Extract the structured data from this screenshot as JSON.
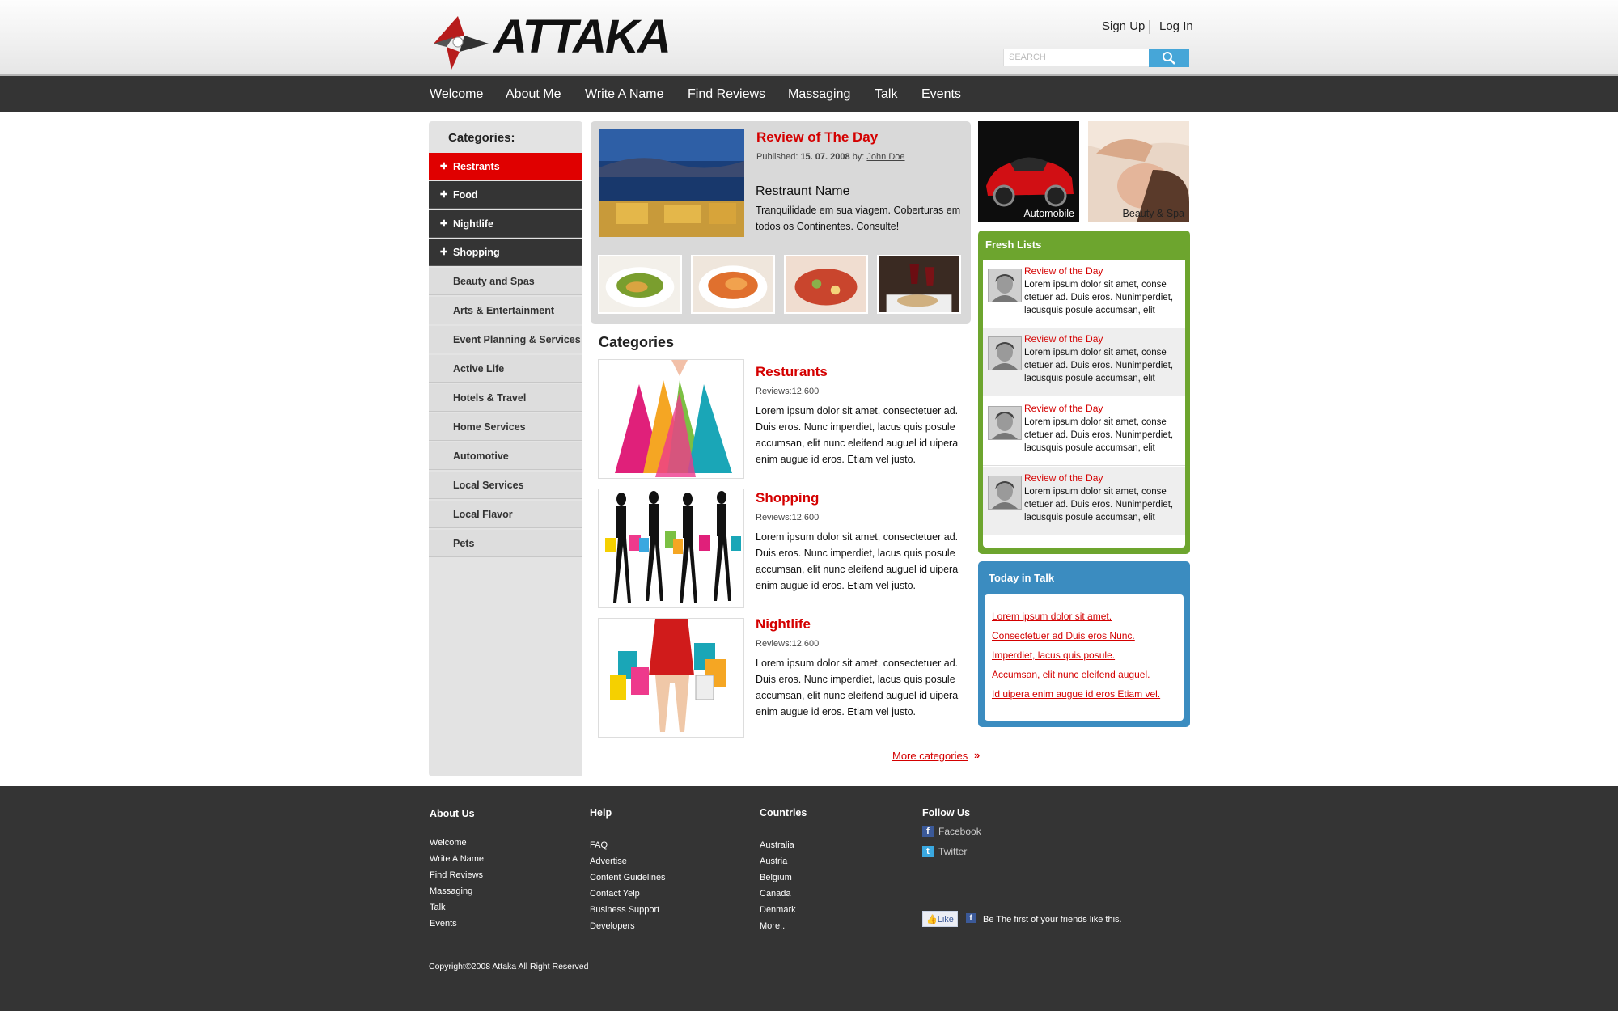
{
  "header": {
    "logo_text": "ATTAKA",
    "sign_up": "Sign Up",
    "log_in": "Log In",
    "search_placeholder": "SEARCH"
  },
  "nav": [
    "Welcome",
    "About Me",
    "Write A Name",
    "Find Reviews",
    "Massaging",
    "Talk",
    "Events"
  ],
  "sidebar": {
    "title": "Categories:",
    "items": [
      {
        "label": "Restrants",
        "style": "active"
      },
      {
        "label": "Food",
        "style": "dark"
      },
      {
        "label": "Nightlife",
        "style": "dark"
      },
      {
        "label": "Shopping",
        "style": "dark"
      },
      {
        "label": "Beauty and Spas",
        "style": "light"
      },
      {
        "label": "Arts & Entertainment",
        "style": "light"
      },
      {
        "label": "Event Planning & Services",
        "style": "light"
      },
      {
        "label": "Active Life",
        "style": "light"
      },
      {
        "label": "Hotels & Travel",
        "style": "light"
      },
      {
        "label": "Home Services",
        "style": "light"
      },
      {
        "label": "Automotive",
        "style": "light"
      },
      {
        "label": "Local Services",
        "style": "light"
      },
      {
        "label": "Local Flavor",
        "style": "light"
      },
      {
        "label": "Pets",
        "style": "light"
      }
    ]
  },
  "featured": {
    "title": "Review of The Day",
    "published_label": "Published:",
    "date": "15. 07. 2008",
    "by_label": "by:",
    "author": "John Doe",
    "name": "Restraunt Name",
    "description": "Tranquilidade em sua viagem. Coberturas  em todos os Continentes. Consulte!"
  },
  "categories": {
    "heading": "Categories",
    "items": [
      {
        "title": "Resturants",
        "reviews": "Reviews:12,600",
        "text": "Lorem ipsum dolor sit amet, consectetuer ad. Duis eros. Nunc imperdiet, lacus quis posule accumsan, elit nunc eleifend auguel id uipera enim augue id eros. Etiam vel justo."
      },
      {
        "title": "Shopping",
        "reviews": "Reviews:12,600",
        "text": "Lorem ipsum dolor sit amet, consectetuer ad. Duis eros. Nunc imperdiet, lacus quis posule accumsan, elit nunc eleifend auguel id uipera enim augue id eros. Etiam vel justo."
      },
      {
        "title": "Nightlife",
        "reviews": "Reviews:12,600",
        "text": "Lorem ipsum dolor sit amet, consectetuer ad. Duis eros. Nunc imperdiet, lacus quis posule accumsan, elit nunc eleifend auguel id uipera enim augue id eros. Etiam vel justo."
      }
    ],
    "more": "More categories"
  },
  "promos": {
    "automobile": "Automobile",
    "beauty": "Beauty & Spa"
  },
  "fresh_lists": {
    "title": "Fresh Lists",
    "items": [
      {
        "title": "Review of the Day",
        "text": "Lorem ipsum dolor sit amet, conse ctetuer ad. Duis eros. Nunimperdiet, lacusquis posule accumsan, elit"
      },
      {
        "title": "Review of the Day",
        "text": "Lorem ipsum dolor sit amet, conse ctetuer ad. Duis eros. Nunimperdiet, lacusquis posule accumsan, elit"
      },
      {
        "title": "Review of the Day",
        "text": "Lorem ipsum dolor sit amet, conse ctetuer ad. Duis eros. Nunimperdiet, lacusquis posule accumsan, elit"
      },
      {
        "title": "Review of the Day",
        "text": "Lorem ipsum dolor sit amet, conse ctetuer ad. Duis eros. Nunimperdiet, lacusquis posule accumsan, elit"
      }
    ]
  },
  "talk": {
    "title": "Today in Talk",
    "links": [
      "Lorem ipsum dolor sit amet.",
      "Consectetuer ad Duis eros Nunc.",
      "Imperdiet, lacus quis posule.",
      "Accumsan, elit nunc eleifend auguel.",
      "Id uipera enim augue id eros Etiam vel."
    ]
  },
  "footer": {
    "about": {
      "title": "About Us",
      "links": [
        "Welcome",
        "Write A Name",
        "Find Reviews",
        "Massaging",
        "Talk",
        "Events"
      ]
    },
    "help": {
      "title": "Help",
      "links": [
        "FAQ",
        "Advertise",
        "Content Guidelines",
        "Contact Yelp",
        "Business Support",
        "Developers"
      ]
    },
    "countries": {
      "title": "Countries",
      "links": [
        "Australia",
        "Austria",
        "Belgium",
        "Canada",
        "Denmark",
        "More.."
      ]
    },
    "follow": {
      "title": "Follow Us",
      "facebook": "Facebook",
      "twitter": "Twitter"
    },
    "like_button": "Like",
    "like_text": "Be The first of your friends like this.",
    "copyright": "Copyright©2008 Attaka All Right Reserved"
  },
  "colors": {
    "accent_red": "#d40000",
    "nav_dark": "#343434",
    "fresh_green": "#6da52e",
    "talk_blue": "#3b8cc0",
    "search_blue": "#46a6d8"
  }
}
